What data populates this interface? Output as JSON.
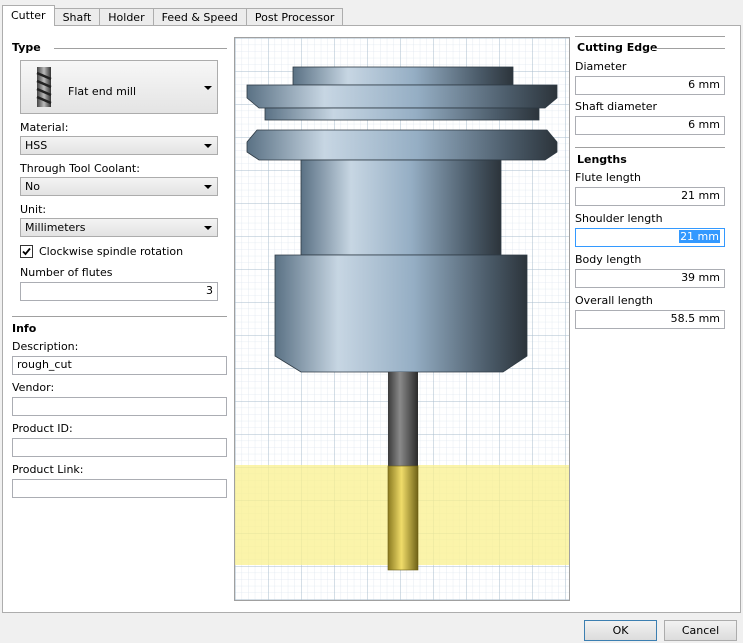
{
  "tabs": [
    "Cutter",
    "Shaft",
    "Holder",
    "Feed & Speed",
    "Post Processor"
  ],
  "type": {
    "title": "Type",
    "cutter_type": "Flat end mill",
    "cutter_icon": "flat-end-mill-icon",
    "material_label": "Material:",
    "material_value": "HSS",
    "coolant_label": "Through Tool Coolant:",
    "coolant_value": "No",
    "unit_label": "Unit:",
    "unit_value": "Millimeters",
    "clockwise_label": "Clockwise spindle rotation",
    "clockwise_checked": true,
    "flutes_label": "Number of flutes",
    "flutes_value": "3"
  },
  "info": {
    "title": "Info",
    "description_label": "Description:",
    "description_value": "rough_cut",
    "vendor_label": "Vendor:",
    "vendor_value": "",
    "product_id_label": "Product ID:",
    "product_id_value": "",
    "product_link_label": "Product Link:",
    "product_link_value": ""
  },
  "cutting_edge": {
    "title": "Cutting Edge",
    "diameter_label": "Diameter",
    "diameter_value": "6 mm",
    "shaft_diameter_label": "Shaft diameter",
    "shaft_diameter_value": "6 mm"
  },
  "lengths": {
    "title": "Lengths",
    "flute_label": "Flute length",
    "flute_value": "21 mm",
    "shoulder_label": "Shoulder length",
    "shoulder_value": "21 mm",
    "body_label": "Body length",
    "body_value": "39 mm",
    "overall_label": "Overall length",
    "overall_value": "58.5 mm"
  },
  "buttons": {
    "ok": "OK",
    "cancel": "Cancel"
  }
}
